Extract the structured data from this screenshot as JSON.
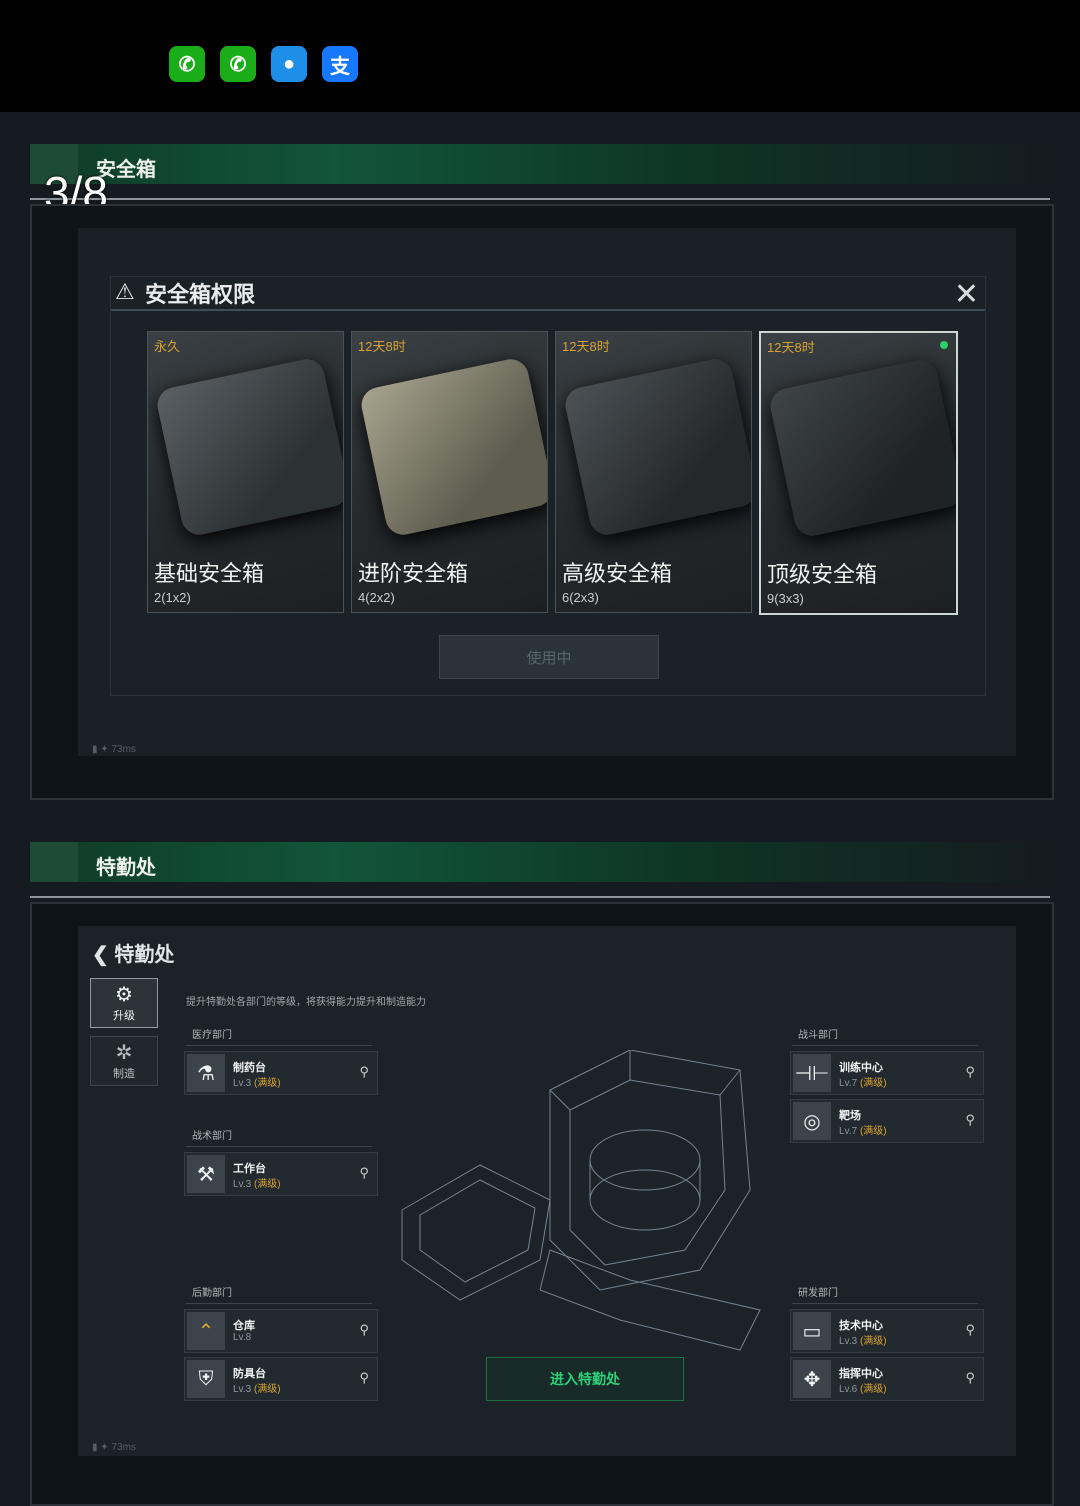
{
  "page_index": "3/8",
  "apps": [
    {
      "icon": "wechat-icon",
      "color": "#1aad19",
      "glyph": "✆"
    },
    {
      "icon": "wechat-icon",
      "color": "#1aad19",
      "glyph": "✆"
    },
    {
      "icon": "message-icon",
      "color": "#1e8fe8",
      "glyph": "●"
    },
    {
      "icon": "alipay-icon",
      "color": "#1677ff",
      "glyph": "支"
    }
  ],
  "section1": {
    "banner_title": "安全箱",
    "dialog_title": "安全箱权限",
    "cards": [
      {
        "duration": "永久",
        "name": "基础安全箱",
        "capacity": "2(1x2)"
      },
      {
        "duration": "12天8时",
        "name": "进阶安全箱",
        "capacity": "4(2x2)"
      },
      {
        "duration": "12天8时",
        "name": "高级安全箱",
        "capacity": "6(2x3)"
      },
      {
        "duration": "12天8时",
        "name": "顶级安全箱",
        "capacity": "9(3x3)"
      }
    ],
    "button": "使用中",
    "status": "73ms"
  },
  "section2": {
    "banner_title": "特勤处",
    "screen_title": "特勤处",
    "tabs": [
      {
        "label": "升级",
        "icon": "upgrade-icon"
      },
      {
        "label": "制造",
        "icon": "gear-icon"
      }
    ],
    "description": "提升特勤处各部门的等级，将获得能力提升和制造能力",
    "departments": {
      "medical": {
        "label": "医疗部门",
        "items": [
          {
            "name": "制药台",
            "level": "Lv.3",
            "max": "(满级)"
          }
        ]
      },
      "tactical": {
        "label": "战术部门",
        "items": [
          {
            "name": "工作台",
            "level": "Lv.3",
            "max": "(满级)"
          }
        ]
      },
      "logistics": {
        "label": "后勤部门",
        "items": [
          {
            "name": "仓库",
            "level": "Lv.8",
            "max": ""
          },
          {
            "name": "防具台",
            "level": "Lv.3",
            "max": "(满级)"
          }
        ]
      },
      "combat": {
        "label": "战斗部门",
        "items": [
          {
            "name": "训练中心",
            "level": "Lv.7",
            "max": "(满级)"
          },
          {
            "name": "靶场",
            "level": "Lv.7",
            "max": "(满级)"
          }
        ]
      },
      "research": {
        "label": "研发部门",
        "items": [
          {
            "name": "技术中心",
            "level": "Lv.3",
            "max": "(满级)"
          },
          {
            "name": "指挥中心",
            "level": "Lv.6",
            "max": "(满级)"
          }
        ]
      }
    },
    "enter_button": "进入特勤处",
    "status": "73ms"
  }
}
